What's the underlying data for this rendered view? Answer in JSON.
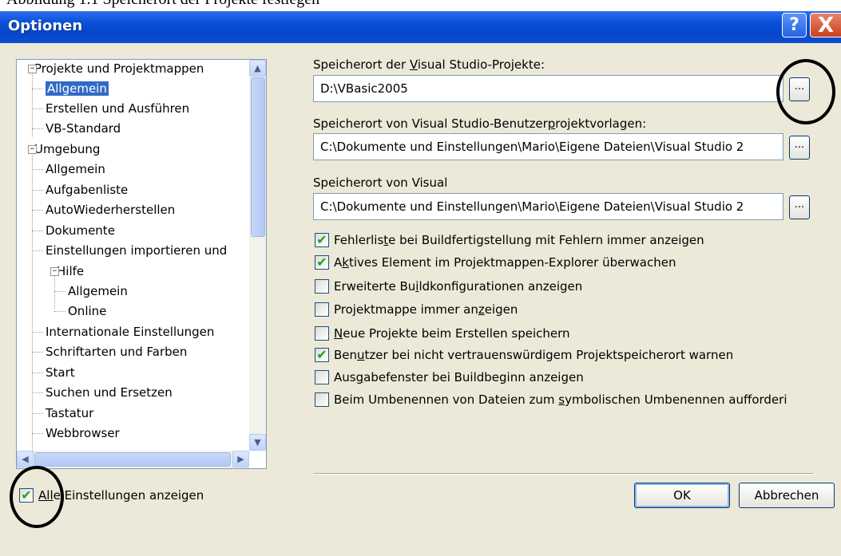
{
  "document": {
    "caption": "Abbildung 1.1 Speicherort der Projekte festlegen"
  },
  "window": {
    "title": "Optionen",
    "help_glyph": "?",
    "close_glyph": "X"
  },
  "tree": {
    "items": [
      {
        "label": "Projekte und Projektmappen",
        "expander": "−"
      },
      {
        "label": "Allgemein",
        "selected": true
      },
      {
        "label": "Erstellen und Ausführen"
      },
      {
        "label": "VB-Standard"
      },
      {
        "label": "Umgebung",
        "expander": "−"
      },
      {
        "label": "Allgemein"
      },
      {
        "label": "Aufgabenliste"
      },
      {
        "label": "AutoWiederherstellen"
      },
      {
        "label": "Dokumente"
      },
      {
        "label": "Einstellungen importieren und"
      },
      {
        "label": "Hilfe",
        "expander": "−"
      },
      {
        "label": "Allgemein"
      },
      {
        "label": "Online"
      },
      {
        "label": "Internationale Einstellungen"
      },
      {
        "label": "Schriftarten und Farben"
      },
      {
        "label": "Start"
      },
      {
        "label": "Suchen und Ersetzen"
      },
      {
        "label": "Tastatur"
      },
      {
        "label": "Webbrowser"
      }
    ],
    "scroll_up": "▲",
    "scroll_down": "▼",
    "scroll_left": "◀",
    "scroll_right": "▶"
  },
  "paths": {
    "projects_label_pre": "Speicherort der ",
    "projects_label_u": "V",
    "projects_label_post": "isual Studio-Projekte:",
    "projects_value": "D:\\VBasic2005",
    "templates_label_pre": "Speicherort von Visual Studio-Benutzer",
    "templates_label_u": "p",
    "templates_label_post": "rojektvorlagen:",
    "templates_value": "C:\\Dokumente und Einstellungen\\Mario\\Eigene Dateien\\Visual Studio 2",
    "visual_label": "Speicherort von Visual",
    "visual_value": "C:\\Dokumente und Einstellungen\\Mario\\Eigene Dateien\\Visual Studio 2",
    "browse_label": "..."
  },
  "checkboxes": [
    {
      "pre": "Fehlerlis",
      "u": "t",
      "post": "e bei Buildfertigstellung mit Fehlern immer anzeigen",
      "checked": true
    },
    {
      "pre": "A",
      "u": "k",
      "post": "tives Element im Projektmappen-Explorer überwachen",
      "checked": true
    },
    {
      "pre": "Erweiterte Bu",
      "u": "i",
      "post": "ldkonfigurationen anzeigen",
      "checked": false
    },
    {
      "pre": "Projektmappe immer an",
      "u": "z",
      "post": "eigen",
      "checked": false
    },
    {
      "pre": "",
      "u": "N",
      "post": "eue Projekte beim Erstellen speichern",
      "checked": false
    },
    {
      "pre": "Ben",
      "u": "u",
      "post": "tzer bei nicht vertrauenswürdigem Projektspeicherort warnen",
      "checked": true
    },
    {
      "pre": "Aus",
      "u": "g",
      "post": "abefenster bei Buildbeginn anzeigen",
      "checked": false
    },
    {
      "pre": "Beim Umbenennen von Dateien zum ",
      "u": "s",
      "post": "ymbolischen Umbenennen aufforderi",
      "checked": false
    }
  ],
  "show_all": {
    "pre": "Al",
    "u": "l",
    "post": "e Einstellungen anzeigen",
    "checked": true
  },
  "buttons": {
    "ok": "OK",
    "cancel": "Abbrechen"
  },
  "tick_glyph": "✔",
  "colors": {
    "titlebar": "#0a50d8",
    "selection": "#316ac5",
    "client": "#ece9d8"
  }
}
